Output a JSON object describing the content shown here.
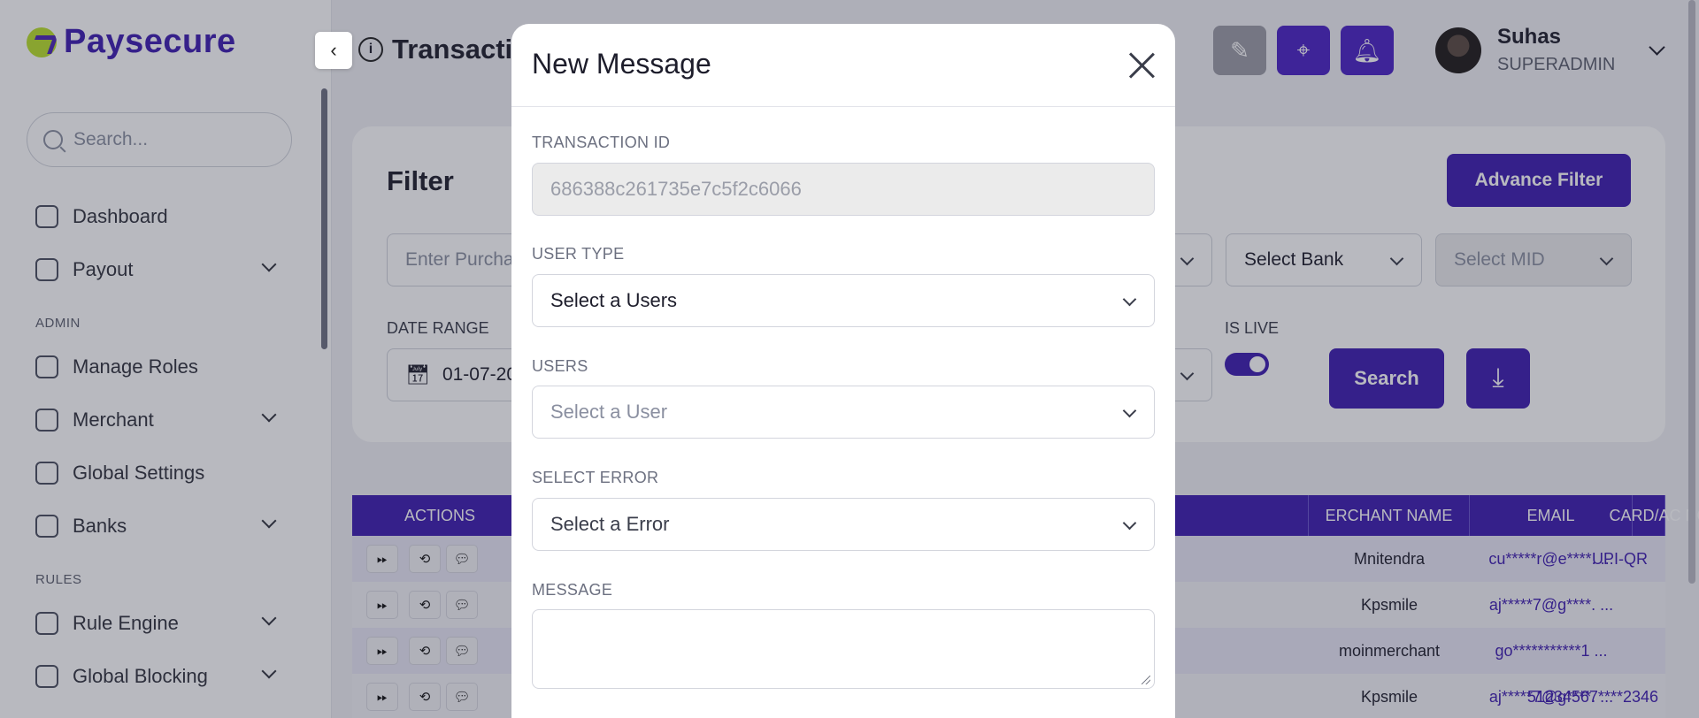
{
  "brand": {
    "name": "Paysecure"
  },
  "sidebar": {
    "search_placeholder": "Search...",
    "items": [
      {
        "label": "Dashboard",
        "icon": "dashboard-icon"
      },
      {
        "label": "Payout",
        "icon": "payout-icon"
      },
      {
        "label": "Manage Roles",
        "icon": "roles-icon"
      },
      {
        "label": "Merchant",
        "icon": "merchant-icon"
      },
      {
        "label": "Global Settings",
        "icon": "settings-icon"
      },
      {
        "label": "Banks",
        "icon": "bank-icon"
      },
      {
        "label": "Rule Engine",
        "icon": "rule-engine-icon"
      },
      {
        "label": "Global Blocking",
        "icon": "blocking-icon"
      }
    ],
    "sections": {
      "admin": "ADMIN",
      "rules": "RULES"
    }
  },
  "header": {
    "title": "Transacti",
    "user_name": "Suhas",
    "user_role": "SUPERADMIN"
  },
  "filter": {
    "title": "Filter",
    "advance_filter_label": "Advance Filter",
    "purchase_placeholder": "Enter Purcha",
    "bank_select": "Select Bank",
    "mid_select": "Select MID",
    "date_range_label": "DATE RANGE",
    "date_value": "01-07-20",
    "is_live_label": "IS LIVE",
    "is_live": true,
    "search_label": "Search"
  },
  "table": {
    "headers": {
      "actions": "ACTIONS",
      "merchant_name": "ERCHANT NAME",
      "email": "EMAIL",
      "card": "CARD/AC NO"
    },
    "rows": [
      {
        "merchant": "Mnitendra",
        "email": "cu*****r@e****. ...",
        "card": "UPI-QR"
      },
      {
        "merchant": "Kpsmile",
        "email": "aj*****7@g****. ...",
        "card": ""
      },
      {
        "merchant": "moinmerchant",
        "email": "go***********1 ...",
        "card": ""
      },
      {
        "merchant": "Kpsmile",
        "email": "aj*****7@g****. ...",
        "card": "51234567****2346"
      }
    ]
  },
  "modal": {
    "title": "New Message",
    "transaction_id_label": "TRANSACTION ID",
    "transaction_id_value": "686388c261735e7c5f2c6066",
    "user_type_label": "USER TYPE",
    "user_type_value": "Select a Users",
    "users_label": "USERS",
    "users_placeholder": "Select a User",
    "error_label": "SELECT ERROR",
    "error_value": "Select a Error",
    "message_label": "MESSAGE",
    "message_value": ""
  },
  "colors": {
    "brand": "#3d1bb0",
    "accent": "#b9e02a"
  }
}
